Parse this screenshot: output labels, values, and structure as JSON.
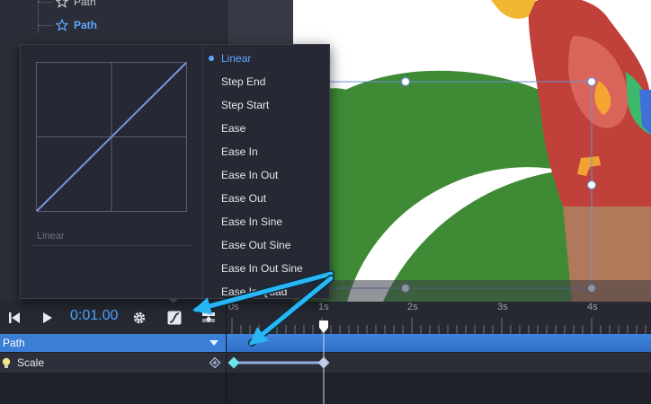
{
  "layers": {
    "items": [
      {
        "label": "Path",
        "state": "dim"
      },
      {
        "label": "Path",
        "state": "active"
      }
    ]
  },
  "transport": {
    "time": "0:01.00",
    "icons": [
      "skip-to-start-icon",
      "play-icon",
      "gear-icon",
      "easing-curve-icon",
      "keyframe-options-icon"
    ]
  },
  "ruler": {
    "labels": [
      "0s",
      "1s",
      "2s",
      "3s",
      "4s"
    ]
  },
  "tracks": {
    "group_label": "Path",
    "property_label": "Scale"
  },
  "easing_menu": {
    "preview_label": "Linear",
    "selected": "Linear",
    "options": [
      {
        "label": "Linear"
      },
      {
        "label": "Step End"
      },
      {
        "label": "Step Start"
      },
      {
        "label": "Ease"
      },
      {
        "label": "Ease In"
      },
      {
        "label": "Ease In Out"
      },
      {
        "label": "Ease Out"
      },
      {
        "label": "Ease In Sine"
      },
      {
        "label": "Ease Out Sine"
      },
      {
        "label": "Ease In Out Sine"
      },
      {
        "label": "Ease In Quad"
      }
    ]
  },
  "colors": {
    "accent": "#4da6ff",
    "track_header": "#3b7ed6",
    "annotation_arrow": "#29b6f6",
    "keyframe": "#8fe3ee",
    "curve_line": "#7b93e6"
  }
}
